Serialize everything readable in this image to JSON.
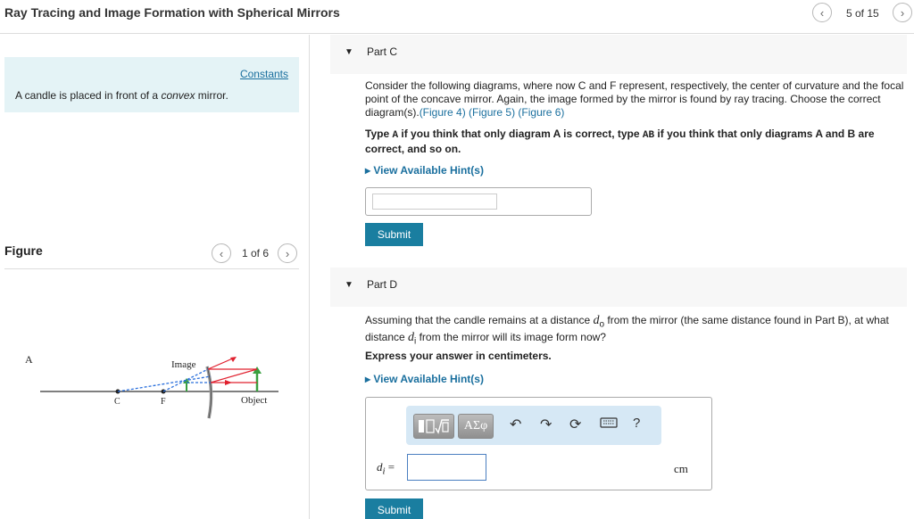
{
  "header": {
    "title": "Ray Tracing and Image Formation with Spherical Mirrors",
    "pager": "5 of 15"
  },
  "left": {
    "constants_link": "Constants",
    "intro_prefix": "A candle is placed in front of a ",
    "intro_em": "convex",
    "intro_suffix": " mirror.",
    "figure_label": "Figure",
    "figure_pager": "1 of 6",
    "diagram": {
      "panel_label": "A",
      "image_label": "Image",
      "object_label": "Object",
      "c_label": "C",
      "f_label": "F"
    }
  },
  "partC": {
    "title": "Part C",
    "text": "Consider the following diagrams, where now C and F represent, respectively, the center of curvature and the focal point of the concave mirror. Again, the image formed by the mirror is found by ray tracing. Choose the correct diagram(s).",
    "fig4": "(Figure 4)",
    "fig5": "(Figure 5)",
    "fig6": "(Figure 6)",
    "instr_1": "Type ",
    "instr_code1": "A",
    "instr_2": " if you think that only diagram A is correct, type ",
    "instr_code2": "AB",
    "instr_3": " if you think that only diagrams A and B are correct, and so on.",
    "hint": "View Available Hint(s)",
    "answer_value": "",
    "submit": "Submit"
  },
  "partD": {
    "title": "Part D",
    "text_1": "Assuming that the candle remains at a distance ",
    "d_o": "d",
    "d_o_sub": "o",
    "text_2": " from the mirror (the same distance found in Part B), at what distance ",
    "d_i": "d",
    "d_i_sub": "i",
    "text_3": " from the mirror will its image form now?",
    "instr": "Express your answer in centimeters.",
    "hint": "View Available Hint(s)",
    "toolbar": {
      "greek_label": "ΑΣφ",
      "help_label": "?"
    },
    "di_label": "d",
    "di_sub": "i",
    "equals": " =",
    "answer_value": "",
    "unit": "cm",
    "submit": "Submit"
  },
  "colors": {
    "link": "#1a6f9e",
    "submit_bg": "#1a7ea0",
    "constants_bg": "#e4f3f6",
    "toolbar_bg": "#d6e8f5",
    "ray_red": "#e0202e",
    "ray_blue": "#2a6fdc",
    "object_green": "#3aa040"
  },
  "icons": {
    "prev": "chevron-left-icon",
    "next": "chevron-right-icon",
    "undo": "undo-icon",
    "redo": "redo-icon",
    "reset": "reset-icon",
    "keyboard": "keyboard-icon"
  }
}
